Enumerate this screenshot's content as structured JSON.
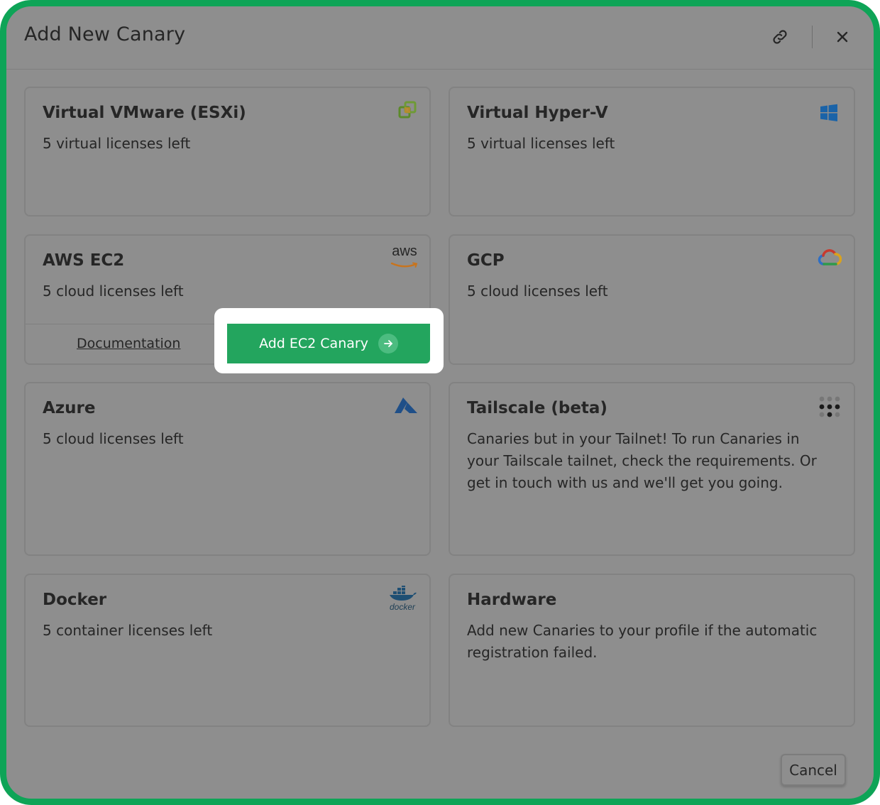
{
  "dialog": {
    "title": "Add New Canary",
    "cancel_label": "Cancel"
  },
  "header_icons": [
    "link-icon",
    "close-icon"
  ],
  "cards": [
    {
      "title": "Virtual VMware (ESXi)",
      "desc": "5 virtual licenses left",
      "icon": "vmware-icon"
    },
    {
      "title": "Virtual Hyper-V",
      "desc": "5 virtual licenses left",
      "icon": "windows-icon"
    },
    {
      "title": "AWS EC2",
      "desc": "5 cloud licenses left",
      "icon": "aws-icon",
      "icon_text": "aws",
      "doc_label": "Documentation",
      "action_label": "Add EC2 Canary"
    },
    {
      "title": "GCP",
      "desc": "5 cloud licenses left",
      "icon": "google-cloud-icon"
    },
    {
      "title": "Azure",
      "desc": "5 cloud licenses left",
      "icon": "azure-icon"
    },
    {
      "title": "Tailscale (beta)",
      "desc": "Canaries but in your Tailnet! To run Canaries in your Tailscale tailnet, check the requirements. Or get in touch with us and we'll get you going.",
      "icon": "tailscale-icon"
    },
    {
      "title": "Docker",
      "desc": "5 container licenses left",
      "icon": "docker-icon",
      "icon_text": "docker"
    },
    {
      "title": "Hardware",
      "desc": "Add new Canaries to your profile if the automatic registration failed."
    }
  ],
  "colors": {
    "frame": "#0ea457",
    "overlay": "#8e8e8e",
    "primary_button": "#23a55e",
    "text": "#262626"
  }
}
